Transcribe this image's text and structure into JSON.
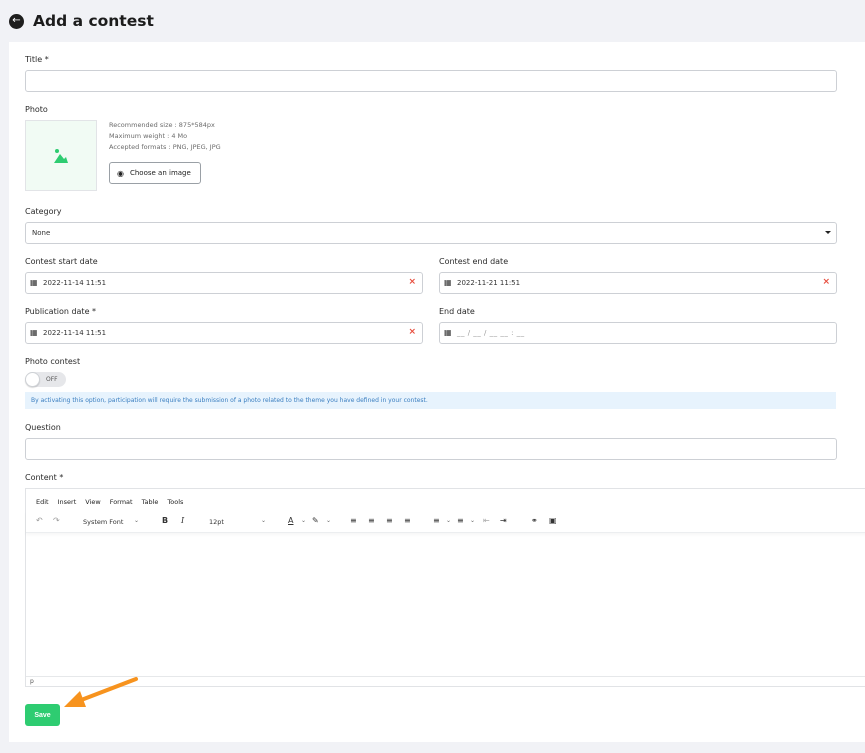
{
  "header": {
    "title": "Add a contest",
    "back_icon": "arrow-left-icon"
  },
  "form": {
    "title_label": "Title *",
    "title_value": "",
    "photo_label": "Photo",
    "photo_info": [
      "Recommended size : 875*584px",
      "Maximum weight : 4 Mo",
      "Accepted formats : PNG, JPEG, JPG"
    ],
    "choose_image_label": "Choose an image",
    "category_label": "Category",
    "category_value": "None",
    "start_label": "Contest start date",
    "start_value": "2022-11-14 11:51",
    "end_label": "Contest end date",
    "end_value": "2022-11-21 11:51",
    "pub_label": "Publication date *",
    "pub_value": "2022-11-14 11:51",
    "enddate_label": "End date",
    "enddate_placeholder": "__ / __ / __ __ : __",
    "photo_contest_label": "Photo contest",
    "toggle_state": "OFF",
    "info_text": "By activating this option, participation will require the submission of a photo related to the theme you have defined in your contest.",
    "question_label": "Question",
    "question_value": "",
    "content_label": "Content *",
    "save_label": "Save"
  },
  "editor": {
    "menus": [
      "Edit",
      "Insert",
      "View",
      "Format",
      "Table",
      "Tools"
    ],
    "font_family": "System Font",
    "font_size": "12pt",
    "status_path": "p"
  },
  "colors": {
    "accent": "#2ecc71",
    "arrow": "#f7931e",
    "clear": "#e74c3c",
    "info_bg": "#e7f3fd"
  }
}
